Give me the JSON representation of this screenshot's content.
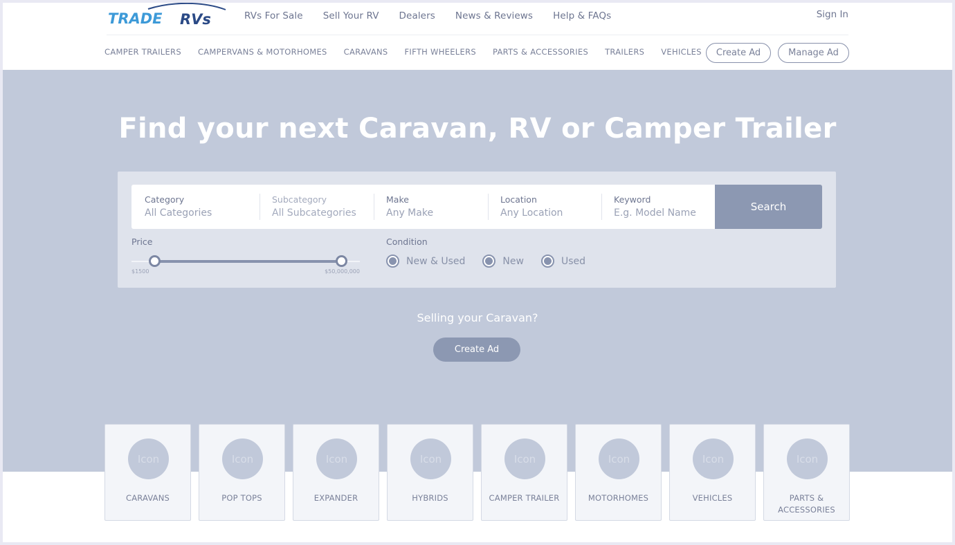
{
  "header": {
    "logo": {
      "part1": "TRADE",
      "part2": "RVs"
    },
    "top_nav": [
      "RVs For Sale",
      "Sell Your RV",
      "Dealers",
      "News & Reviews",
      "Help & FAQs"
    ],
    "sign_in": "Sign In",
    "category_nav": [
      "CAMPER TRAILERS",
      "CAMPERVANS & MOTORHOMES",
      "CARAVANS",
      "FIFTH WHEELERS",
      "PARTS & ACCESSORIES",
      "TRAILERS",
      "VEHICLES"
    ],
    "create_ad": "Create Ad",
    "manage_ad": "Manage Ad"
  },
  "hero": {
    "title": "Find your next Caravan, RV or Camper Trailer",
    "search": {
      "fields": [
        {
          "label": "Category",
          "value": "All Categories"
        },
        {
          "label": "Subcategory",
          "value": "All Subcategories"
        },
        {
          "label": "Make",
          "value": "Any Make"
        },
        {
          "label": "Location",
          "value": "Any Location"
        },
        {
          "label": "Keyword",
          "placeholder": "E.g. Model Name"
        }
      ],
      "button": "Search"
    },
    "price": {
      "label": "Price",
      "min_label": "$1500",
      "max_label": "$50,000,000",
      "range_start_fraction": 0.1,
      "range_end_fraction": 0.92
    },
    "condition": {
      "label": "Condition",
      "options": [
        "New & Used",
        "New",
        "Used"
      ]
    },
    "selling_text": "Selling your Caravan?",
    "create_ad": "Create Ad"
  },
  "categories": {
    "icon_text": "Icon",
    "items": [
      "CARAVANS",
      "POP TOPS",
      "EXPANDER",
      "HYBRIDS",
      "CAMPER TRAILER",
      "MOTORHOMES",
      "VEHICLES",
      "PARTS & ACCESSORIES"
    ]
  },
  "colors": {
    "hero_bg": "#c1c9da",
    "button": "#8c98b2",
    "logo_blue": "#3d9ad8",
    "logo_navy": "#2b4a86"
  }
}
